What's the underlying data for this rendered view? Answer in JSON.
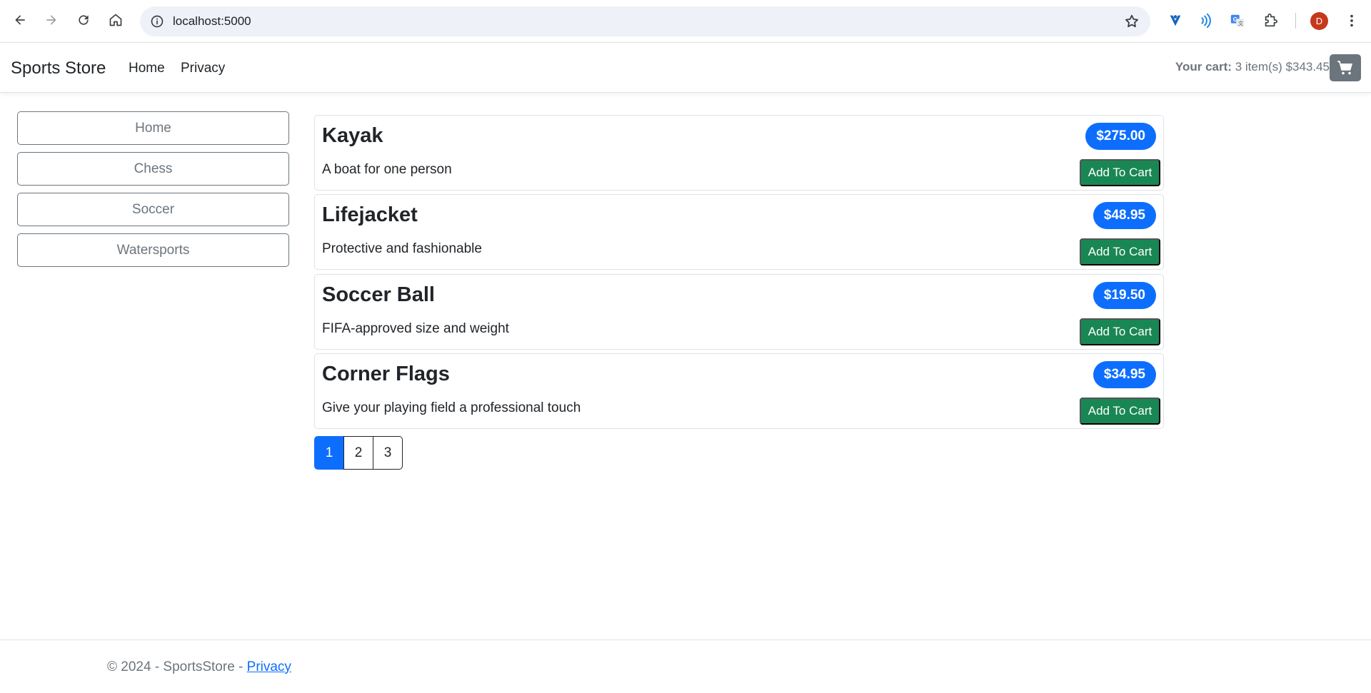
{
  "browser": {
    "url": "localhost:5000",
    "profile_initial": "D"
  },
  "header": {
    "brand": "Sports Store",
    "nav": [
      {
        "label": "Home"
      },
      {
        "label": "Privacy"
      }
    ],
    "cart": {
      "label": "Your cart:",
      "summary": "3 item(s) $343.45"
    }
  },
  "sidebar": {
    "categories": [
      {
        "label": "Home"
      },
      {
        "label": "Chess"
      },
      {
        "label": "Soccer"
      },
      {
        "label": "Watersports"
      }
    ]
  },
  "products": [
    {
      "name": "Kayak",
      "price": "$275.00",
      "description": "A boat for one person",
      "button": "Add To Cart"
    },
    {
      "name": "Lifejacket",
      "price": "$48.95",
      "description": "Protective and fashionable",
      "button": "Add To Cart"
    },
    {
      "name": "Soccer Ball",
      "price": "$19.50",
      "description": "FIFA-approved size and weight",
      "button": "Add To Cart"
    },
    {
      "name": "Corner Flags",
      "price": "$34.95",
      "description": "Give your playing field a professional touch",
      "button": "Add To Cart"
    }
  ],
  "pagination": {
    "pages": [
      "1",
      "2",
      "3"
    ],
    "active": "1"
  },
  "footer": {
    "text": "© 2024 - SportsStore - ",
    "link": "Privacy"
  },
  "colors": {
    "primary": "#0d6efd",
    "success": "#198754",
    "secondary": "#6c757d"
  }
}
